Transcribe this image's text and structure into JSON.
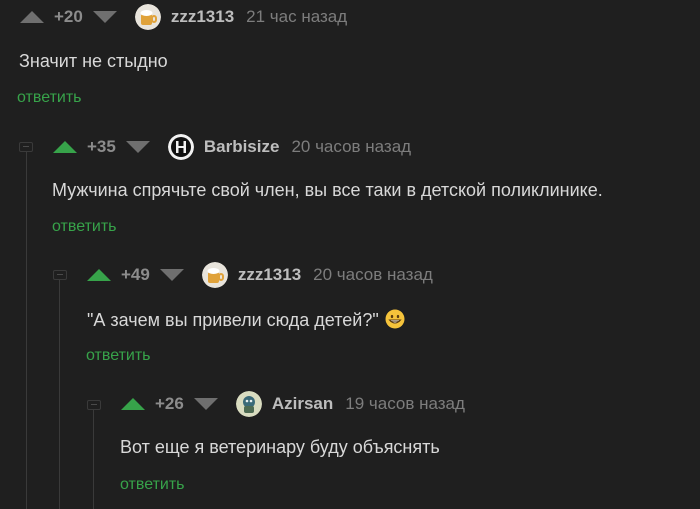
{
  "comments": [
    {
      "rating": "+20",
      "username": "zzz1313",
      "time": "21 час назад",
      "text": "Значит не стыдно",
      "reply_label": "ответить"
    },
    {
      "rating": "+35",
      "username": "Barbisize",
      "time": "20 часов назад",
      "text": "Мужчина  спрячьте свой член, вы все таки в детской поликлинике.",
      "reply_label": "ответить"
    },
    {
      "rating": "+49",
      "username": "zzz1313",
      "time": "20 часов назад",
      "text": "\"А зачем вы привели сюда детей?\"",
      "reply_label": "ответить"
    },
    {
      "rating": "+26",
      "username": "Azirsan",
      "time": "19 часов назад",
      "text": "Вот еще я ветеринару буду объяснять",
      "reply_label": "ответить"
    }
  ],
  "colors": {
    "background": "#1f1f1f",
    "upvote_active": "#37a34a",
    "reply_link": "#37a34a"
  }
}
